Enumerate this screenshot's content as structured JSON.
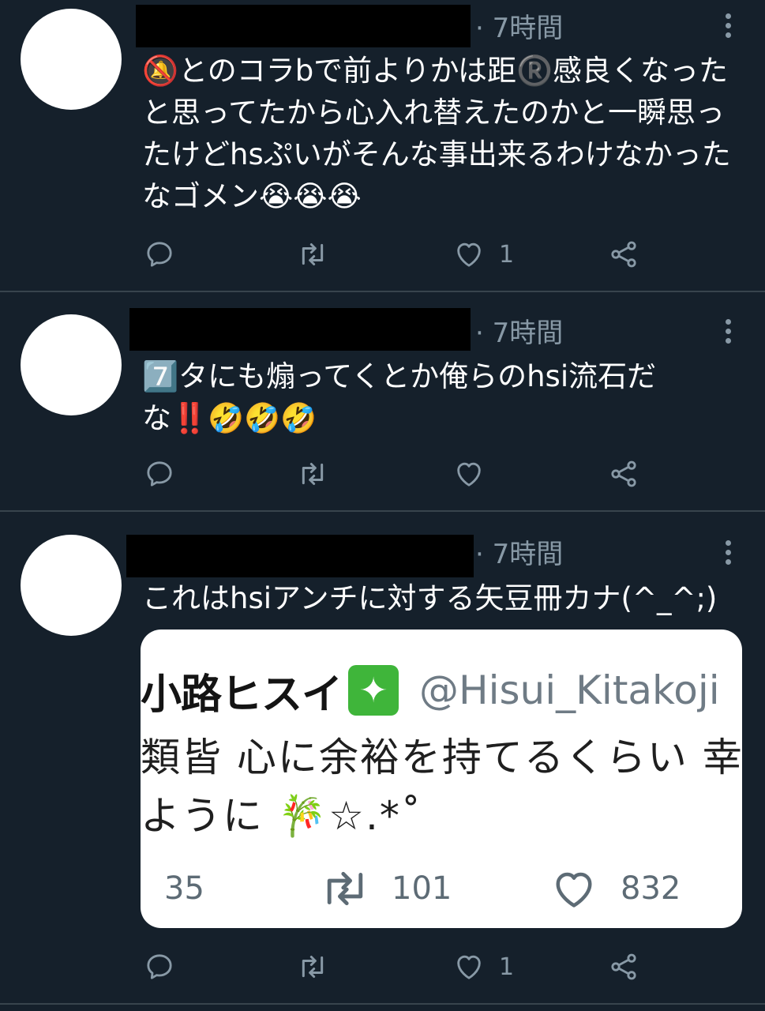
{
  "tweets": [
    {
      "time": "· 7時間",
      "text": "🔕とのコラbで前よりかは距®️感良くなったと思ってたから心入れ替えたのかと一瞬思ったけどhsぷいがそんな事出来るわけなかったなゴメン😭😭😭",
      "actions": {
        "reply_count": "",
        "retweet_count": "",
        "like_count": "1"
      }
    },
    {
      "time": "· 7時間",
      "text": "7️⃣タにも煽ってくとか俺らのhsi流石だな‼️🤣🤣🤣",
      "actions": {
        "reply_count": "",
        "retweet_count": "",
        "like_count": ""
      }
    },
    {
      "time": "· 7時間",
      "text": "これはhsiアンチに対する矢豆冊カナ(^_^;)",
      "actions": {
        "reply_count": "",
        "retweet_count": "",
        "like_count": "1"
      },
      "quote": {
        "name": "小路ヒスイ",
        "badge": "✦",
        "handle": "@Hisui_Kitakoji",
        "line1": "類皆 心に余裕を持てるくらい 幸",
        "line2": "ように 🎋☆.*˚",
        "stats": {
          "replies": "35",
          "retweets": "101",
          "likes": "832"
        }
      }
    }
  ],
  "icons": [
    "reply-icon",
    "retweet-icon",
    "like-icon",
    "share-icon",
    "more-icon"
  ],
  "colors": {
    "background": "#15202b",
    "secondary_text": "#8899a6",
    "divider": "#38444d",
    "quote_bg": "#ffffff"
  }
}
